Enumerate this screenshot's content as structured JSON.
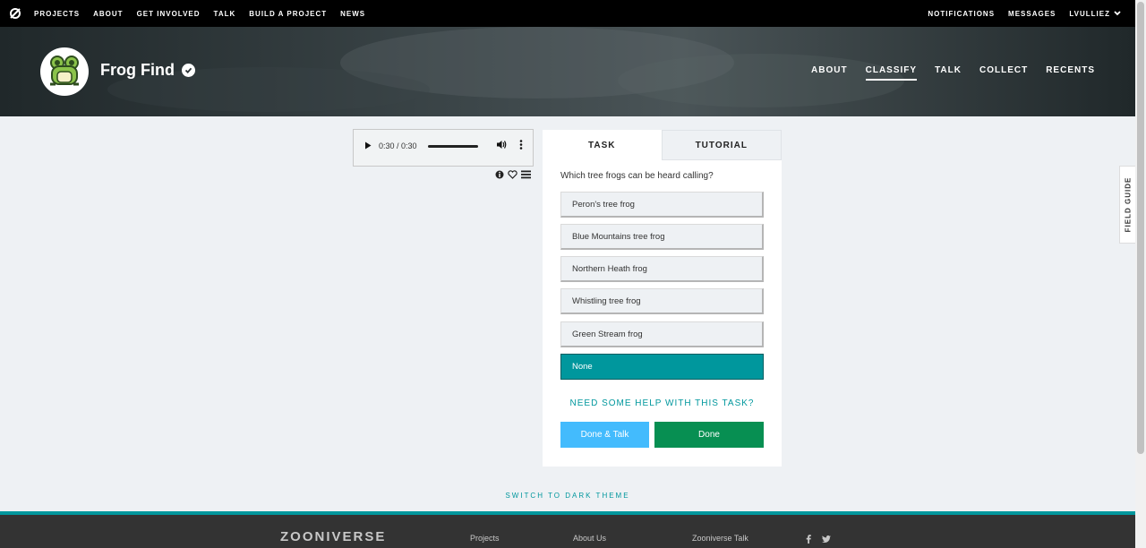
{
  "topnav": {
    "items": [
      "PROJECTS",
      "ABOUT",
      "GET INVOLVED",
      "TALK",
      "BUILD A PROJECT",
      "NEWS"
    ],
    "notifications": "NOTIFICATIONS",
    "messages": "MESSAGES",
    "user": "LVULLIEZ"
  },
  "project": {
    "title": "Frog Find",
    "nav": [
      "ABOUT",
      "CLASSIFY",
      "TALK",
      "COLLECT",
      "RECENTS"
    ]
  },
  "audio": {
    "time": "0:30 / 0:30",
    "progress": 1.0
  },
  "task": {
    "tabs": [
      "TASK",
      "TUTORIAL"
    ],
    "question": "Which tree frogs can be heard calling?",
    "answers": [
      "Peron's tree frog",
      "Blue Mountains tree frog",
      "Northern Heath frog",
      "Whistling tree frog",
      "Green Stream frog",
      "None"
    ],
    "selected": "None",
    "help": "NEED SOME HELP WITH THIS TASK?",
    "done_talk": "Done & Talk",
    "done": "Done"
  },
  "field_guide": "FIELD GUIDE",
  "dark_theme": "SWITCH TO DARK THEME",
  "footer": {
    "brand": "ZOONIVERSE",
    "col1": "Projects",
    "col2": "About Us",
    "col3": "Zooniverse Talk"
  },
  "colors": {
    "accent": "#00979d",
    "done": "#078f52",
    "done_talk": "#43bbfd",
    "topnav": "#000000"
  }
}
